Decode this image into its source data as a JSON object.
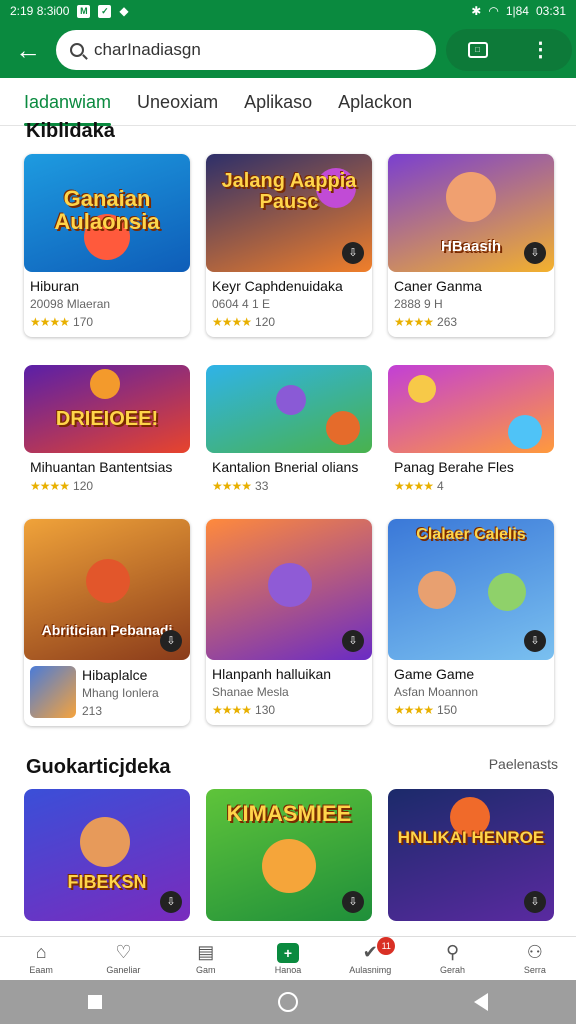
{
  "status_bar": {
    "time_left": "2:19 8:3i00",
    "battery": "1|84",
    "time_right": "03:31"
  },
  "search": {
    "query": "charInadiasgn"
  },
  "tabs": [
    "Iadanwiam",
    "Uneoxiam",
    "Aplikaso",
    "Aplackon"
  ],
  "section1": {
    "title": "Kiblidaka"
  },
  "cards_row1": [
    {
      "art_text": "Ganaian Aulaonsia",
      "title": "Hiburan",
      "sub": "20098 Mlaeran",
      "stars": "★★★★",
      "rating": "170"
    },
    {
      "art_text": "Jalang Aappia Pausc",
      "title": "Keyr Caphdenuidaka",
      "sub": "0604 4 1 E",
      "stars": "★★★★",
      "rating": "120"
    },
    {
      "art_text": "HBaasih",
      "title": "Caner Ganma",
      "sub": "2888 9 H",
      "stars": "★★★★",
      "rating": "263"
    }
  ],
  "cards_row2": [
    {
      "art_text": "DRIEIOEE!",
      "title": "Mihuantan Bantentsias",
      "stars": "★★★★",
      "rating": "120"
    },
    {
      "art_text": "",
      "title": "Kantalion Bnerial olians",
      "stars": "★★★★",
      "rating": "33"
    },
    {
      "art_text": "",
      "title": "Panag Berahe Fles",
      "stars": "★★★★",
      "rating": "4"
    }
  ],
  "cards_row3": [
    {
      "art_text": "Abritician Pebanadi",
      "title": "Hibaplalce",
      "sub": "Mhang Ionlera",
      "rating": "213"
    },
    {
      "art_text": "",
      "title": "Hlanpanh halluikan",
      "sub": "Shanae Mesla",
      "stars": "★★★★",
      "rating": "130"
    },
    {
      "art_text": "Clalaer Calelis",
      "title": "Game Game",
      "sub": "Asfan Moannon",
      "stars": "★★★★",
      "rating": "150"
    }
  ],
  "section2": {
    "title": "Guokarticjdeka",
    "see_all": "Paelenasts"
  },
  "cards_row4": [
    {
      "art_text": "FIBEKSN"
    },
    {
      "art_text": "KIMASMIEE"
    },
    {
      "art_text": "HNLIKAI HENROE"
    }
  ],
  "bottom_nav": [
    {
      "label": "Eaam",
      "icon": "⌂"
    },
    {
      "label": "Ganeliar",
      "icon": "♡"
    },
    {
      "label": "Gam",
      "icon": "▤"
    },
    {
      "label": "Hanoa",
      "icon": "+"
    },
    {
      "label": "Aulasnimg",
      "icon": "✔",
      "badge": "11"
    },
    {
      "label": "Gerah",
      "icon": "⚲"
    },
    {
      "label": "Serra",
      "icon": "⚇"
    }
  ],
  "colors": {
    "brand": "#0a8a3f",
    "star": "#e8b000"
  }
}
